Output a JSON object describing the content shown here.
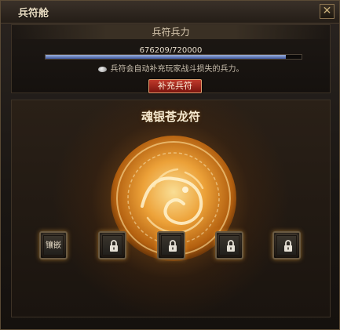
{
  "window": {
    "title": "兵符舱",
    "close_glyph": "✕"
  },
  "soldier": {
    "header": "兵符兵力",
    "power_text": "676209/720000",
    "power_fraction": 0.939,
    "hint": "兵符会自动补充玩家战斗损失的兵力。",
    "supply_button": "补充兵符"
  },
  "talisman": {
    "name": "魂银苍龙符",
    "slots": [
      {
        "label": "镶嵌",
        "state": "open"
      },
      {
        "state": "locked",
        "icon": "lock-icon"
      },
      {
        "state": "locked",
        "icon": "lock-icon"
      },
      {
        "state": "locked",
        "icon": "lock-icon"
      },
      {
        "state": "locked",
        "icon": "lock-icon"
      }
    ]
  },
  "colors": {
    "bar_fill": "#5a72b8",
    "button_red": "#a82a1e",
    "glow": "#f0a030"
  }
}
